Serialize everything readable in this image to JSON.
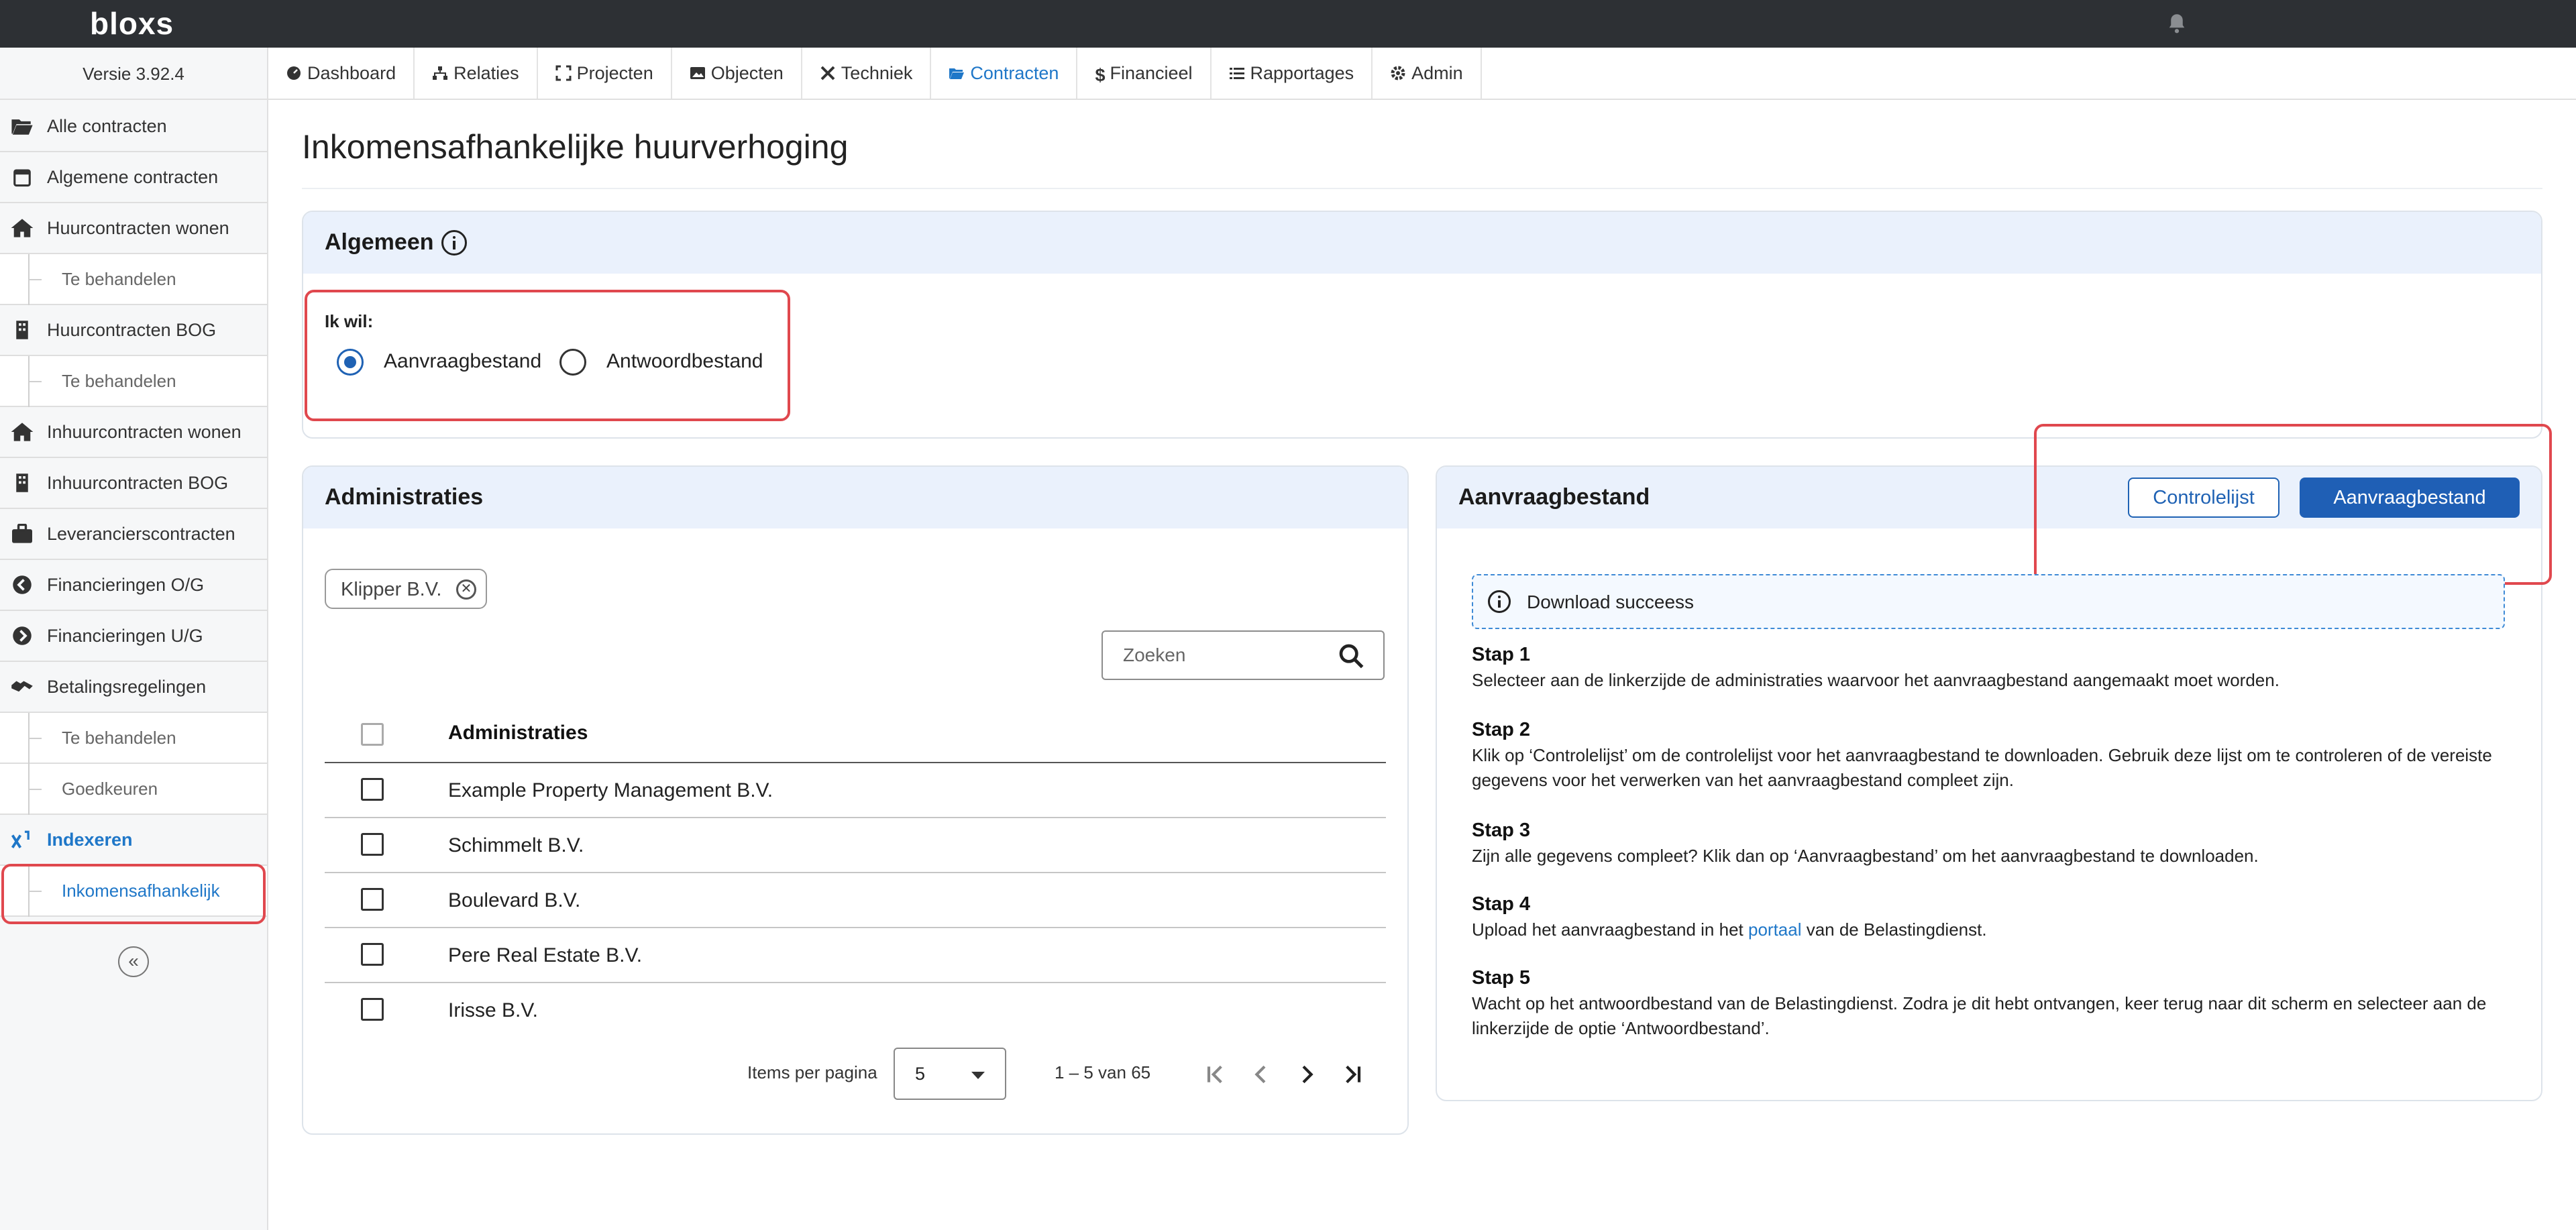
{
  "app": {
    "brand": "bloxs",
    "version": "Versie 3.92.4"
  },
  "nav": {
    "items": [
      {
        "label": "Dashboard",
        "icon": "dashboard-icon"
      },
      {
        "label": "Relaties",
        "icon": "relations-icon"
      },
      {
        "label": "Projecten",
        "icon": "projects-icon"
      },
      {
        "label": "Objecten",
        "icon": "objects-icon"
      },
      {
        "label": "Techniek",
        "icon": "tools-icon"
      },
      {
        "label": "Contracten",
        "icon": "folder-open-icon",
        "active": true
      },
      {
        "label": "Financieel",
        "icon": "dollar-icon"
      },
      {
        "label": "Rapportages",
        "icon": "list-icon"
      },
      {
        "label": "Admin",
        "icon": "gear-icon"
      }
    ]
  },
  "sidebar": {
    "items": [
      {
        "label": "Alle contracten",
        "icon": "folder-open-icon"
      },
      {
        "label": "Algemene contracten",
        "icon": "calendar-icon"
      },
      {
        "label": "Huurcontracten wonen",
        "icon": "home-icon"
      },
      {
        "label": "Te behandelen"
      },
      {
        "label": "Huurcontracten BOG",
        "icon": "building-icon"
      },
      {
        "label": "Te behandelen"
      },
      {
        "label": "Inhuurcontracten wonen",
        "icon": "home-icon"
      },
      {
        "label": "Inhuurcontracten BOG",
        "icon": "building-icon"
      },
      {
        "label": "Leverancierscontracten",
        "icon": "briefcase-icon"
      },
      {
        "label": "Financieringen O/G",
        "icon": "arrow-circle-left-icon"
      },
      {
        "label": "Financieringen U/G",
        "icon": "arrow-circle-right-icon"
      },
      {
        "label": "Betalingsregelingen",
        "icon": "handshake-icon"
      },
      {
        "label": "Te behandelen"
      },
      {
        "label": "Goedkeuren"
      },
      {
        "label": "Indexeren",
        "icon": "superscript-icon"
      },
      {
        "label": "Inkomensafhankelijk"
      }
    ]
  },
  "page": {
    "title": "Inkomensafhankelijke huurverhoging"
  },
  "general": {
    "title": "Algemeen",
    "prompt": "Ik wil:",
    "options": [
      "Aanvraagbestand",
      "Antwoordbestand"
    ],
    "selected": "Aanvraagbestand"
  },
  "administraties": {
    "title": "Administraties",
    "chip": "Klipper B.V.",
    "search_placeholder": "Zoeken",
    "column": "Administraties",
    "rows": [
      "Example Property Management B.V.",
      "Schimmelt B.V.",
      "Boulevard B.V.",
      "Pere Real Estate B.V.",
      "Irisse B.V."
    ],
    "pagination": {
      "label": "Items per pagina",
      "per_page": "5",
      "range": "1 – 5 van 65"
    }
  },
  "aanvraag": {
    "title": "Aanvraagbestand",
    "btn_controle": "Controlelijst",
    "btn_aanvraag": "Aanvraagbestand",
    "alert": "Download succeess",
    "steps": [
      {
        "title": "Stap 1",
        "text": "Selecteer aan de linkerzijde de administraties waarvoor het aanvraagbestand aangemaakt moet worden."
      },
      {
        "title": "Stap 2",
        "text": "Klik op ‘Controlelijst’ om de controlelijst voor het aanvraagbestand te downloaden. Gebruik deze lijst om te controleren of de vereiste gegevens voor het verwerken van het aanvraagbestand compleet zijn."
      },
      {
        "title": "Stap 3",
        "text": "Zijn alle gegevens compleet? Klik dan op ‘Aanvraagbestand’ om het aanvraagbestand te downloaden."
      },
      {
        "title": "Stap 4",
        "text_before": "Upload het aanvraagbestand in het ",
        "link": "portaal",
        "text_after": " van de Belastingdienst."
      },
      {
        "title": "Stap 5",
        "text": "Wacht op het antwoordbestand van de Belastingdienst. Zodra je dit hebt ontvangen, keer terug naar dit scherm en selecteer aan de linkerzijde de optie ‘Antwoordbestand’."
      }
    ]
  },
  "colors": {
    "accent": "#1f62b4",
    "link": "#1f77c8",
    "highlight": "#e0484e",
    "topbar": "#2d3034",
    "card_header": "#eaf1fc"
  }
}
